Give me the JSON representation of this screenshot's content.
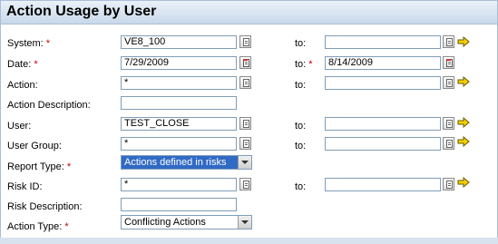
{
  "header": {
    "title": "Action Usage by User"
  },
  "form": {
    "system": {
      "label": "System:",
      "req": "*",
      "value": "VE8_100",
      "to_label": "to:",
      "to_value": ""
    },
    "date": {
      "label": "Date:",
      "req": "*",
      "value": "7/29/2009",
      "to_label": "to:",
      "to_req": "*",
      "to_value": "8/14/2009"
    },
    "action": {
      "label": "Action:",
      "value": "*",
      "to_label": "to:",
      "to_value": ""
    },
    "action_description": {
      "label": "Action Description:",
      "value": ""
    },
    "user": {
      "label": "User:",
      "value": "TEST_CLOSE",
      "to_label": "to:",
      "to_value": ""
    },
    "user_group": {
      "label": "User Group:",
      "value": "*",
      "to_label": "to:",
      "to_value": ""
    },
    "report_type": {
      "label": "Report Type:",
      "req": "*",
      "value": "Actions defined in risks"
    },
    "risk_id": {
      "label": "Risk ID:",
      "value": "*",
      "to_label": "to:",
      "to_value": ""
    },
    "risk_description": {
      "label": "Risk Description:",
      "value": ""
    },
    "action_type": {
      "label": "Action Type:",
      "req": "*",
      "value": "Conflicting Actions"
    }
  },
  "icons": {
    "value_help": "value-help-icon",
    "calendar": "calendar-icon",
    "multiple_selection": "arrow-right-icon",
    "dropdown": "chevron-down-icon"
  },
  "colors": {
    "header_bg": "#c9d9ea",
    "required": "#c00000",
    "selected_dropdown": "#316ac5",
    "arrow": "#f5d000"
  }
}
